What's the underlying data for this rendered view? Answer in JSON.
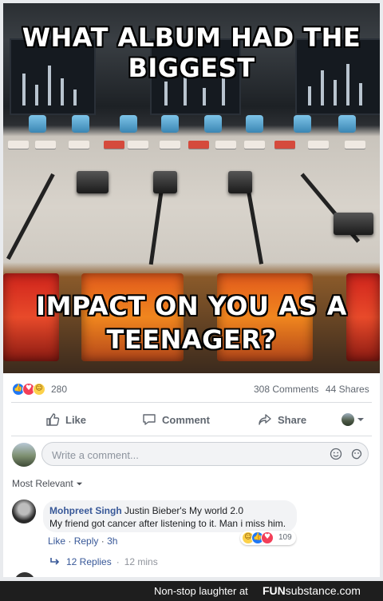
{
  "post": {
    "meme": {
      "caption_top_line1": "WHAT ALBUM HAD THE",
      "caption_top_line2": "BIGGEST",
      "caption_bottom_line1": "IMPACT ON YOU AS A",
      "caption_bottom_line2": "TEENAGER?"
    },
    "reactions": {
      "types": [
        "like-icon",
        "love-icon",
        "haha-icon"
      ],
      "count": "280",
      "comments": "308 Comments",
      "shares": "44 Shares"
    },
    "actions": {
      "like": "Like",
      "comment": "Comment",
      "share": "Share"
    },
    "composer": {
      "placeholder": "Write a comment..."
    },
    "sort_label": "Most Relevant",
    "comment": {
      "author": "Mohpreet Singh",
      "text_line1": "Justin Bieber's My world 2.0",
      "text_line2": "My friend got cancer after listening to it. Man i miss him.",
      "reaction_count": "109",
      "reaction_types": [
        "haha-icon",
        "like-icon",
        "love-icon"
      ],
      "like_label": "Like",
      "reply_label": "Reply",
      "time": "3h",
      "replies": "12 Replies",
      "replies_time": "12 mins"
    }
  },
  "footer": {
    "tagline": "Non-stop laughter at",
    "brand_fun": "FUN",
    "brand_sub": "substance",
    "brand_dom": ".com"
  },
  "colors": {
    "link": "#385898",
    "like_blue": "#2078f4",
    "love_red": "#f33e58",
    "haha_yellow": "#fcd14a"
  }
}
